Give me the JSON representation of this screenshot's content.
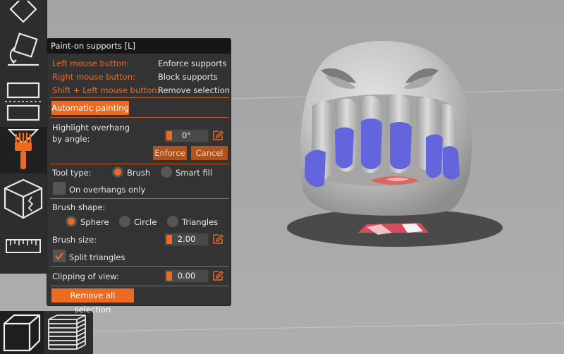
{
  "panel": {
    "title": "Paint-on supports [L]",
    "shortcuts": [
      {
        "key": "Left mouse button:",
        "action": "Enforce supports"
      },
      {
        "key": "Right mouse button:",
        "action": "Block supports"
      },
      {
        "key": "Shift + Left mouse button:",
        "action": "Remove selection"
      }
    ],
    "automatic_painting": "Automatic painting",
    "highlight_label": "Highlight overhang\nby angle:",
    "highlight_value": "0°",
    "enforce": "Enforce",
    "cancel": "Cancel",
    "tool_type_label": "Tool type:",
    "tool_type_options": [
      "Brush",
      "Smart fill"
    ],
    "tool_type_selected": "Brush",
    "on_overhangs_only": "On overhangs only",
    "brush_shape_label": "Brush shape:",
    "brush_shape_options": [
      "Sphere",
      "Circle",
      "Triangles"
    ],
    "brush_shape_selected": "Sphere",
    "brush_size_label": "Brush size:",
    "brush_size_value": "2.00",
    "split_triangles": "Split triangles",
    "split_triangles_checked": true,
    "clipping_label": "Clipping of view:",
    "clipping_value": "0.00",
    "remove_all": "Remove all selection"
  },
  "toolbar": {
    "items": [
      "move-tool-icon",
      "place-on-face-icon",
      "cut-icon",
      "paint-supports-icon",
      "seam-painting-icon",
      "measure-icon"
    ],
    "active": "paint-supports-icon"
  },
  "bottom_toolbar": {
    "items": [
      "3d-view-icon",
      "layers-preview-icon"
    ],
    "active": "3d-view-icon"
  },
  "colors": {
    "accent": "#ed6b21",
    "panel_bg": "#303030",
    "enforced_paint": "#6464dc",
    "blocked_paint": "#dc6464",
    "model_gray": "#c4c4c4"
  }
}
